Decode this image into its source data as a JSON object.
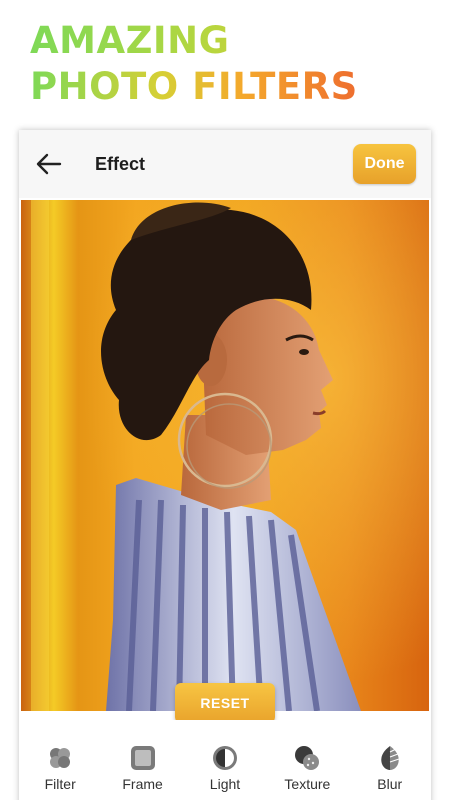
{
  "promo": {
    "line1": "AMAZING",
    "line2": "PHOTO FILTERS"
  },
  "header": {
    "title": "Effect",
    "done_label": "Done",
    "back_icon": "back-arrow-icon"
  },
  "photo": {
    "reset_label": "RESET"
  },
  "tools": [
    {
      "label": "Filter",
      "icon": "filter-icon"
    },
    {
      "label": "Frame",
      "icon": "frame-icon"
    },
    {
      "label": "Light",
      "icon": "light-icon"
    },
    {
      "label": "Texture",
      "icon": "texture-icon"
    },
    {
      "label": "Blur",
      "icon": "blur-icon"
    }
  ],
  "colors": {
    "accent": "#f0b432",
    "headline_green": "#7ed957",
    "headline_orange": "#ee6d2e",
    "topbar": "#f7f7f7"
  }
}
